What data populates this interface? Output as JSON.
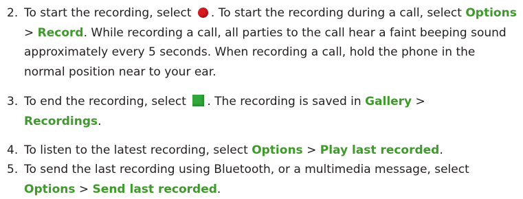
{
  "steps": [
    {
      "number": "2.",
      "part1": "To start the recording, select",
      "part2": ". To start the recording during a call, select",
      "link1": "Options",
      "sep1": ">",
      "link2": "Record",
      "part3": ". While recording a call, all parties to the call hear a faint beeping sound approximately every 5 seconds. When recording a call, hold the phone in the normal position near to your ear.",
      "icon": "record-icon"
    },
    {
      "number": "3.",
      "part1": "To end the recording, select",
      "part2": ". The recording is saved in",
      "link1": "Gallery",
      "sep1": ">",
      "link2": "Recordings",
      "part3": ".",
      "icon": "stop-icon"
    },
    {
      "number": "4.",
      "part1": "To listen to the latest recording, select",
      "link1": "Options",
      "sep1": ">",
      "link2": "Play last recorded",
      "part3": "."
    },
    {
      "number": "5.",
      "part1": "To send the last recording using Bluetooth, or a multimedia message, select",
      "link1": "Options",
      "sep1": ">",
      "link2": "Send last recorded",
      "part3": "."
    }
  ],
  "colors": {
    "text": "#231f20",
    "link": "#3e9a2a",
    "record_icon": "#d71920",
    "stop_icon": "#2fa73a"
  }
}
